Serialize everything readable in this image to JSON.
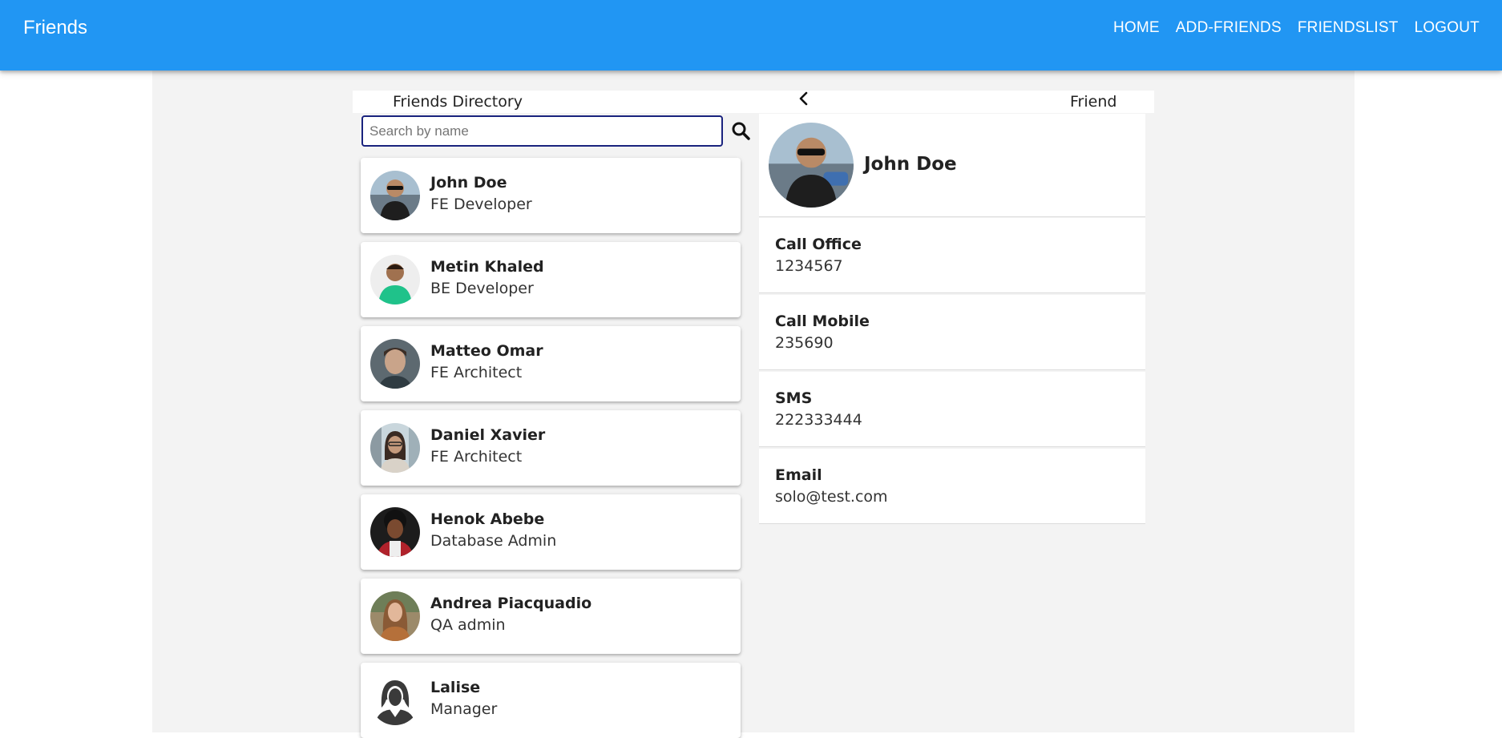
{
  "app": {
    "title": "Friends"
  },
  "nav": [
    {
      "label": "HOME"
    },
    {
      "label": "ADD-FRIENDS"
    },
    {
      "label": "FRIENDSLIST"
    },
    {
      "label": "LOGOUT"
    }
  ],
  "colors": {
    "appbar": "#2196f3",
    "page_bg": "#f3f3f3",
    "search_border": "#1a237e"
  },
  "directory": {
    "title": "Friends Directory",
    "search_placeholder": "Search by name",
    "search_icon": "search-icon"
  },
  "friends": [
    {
      "name": "John Doe",
      "role": "FE Developer",
      "avatar": "man-sunglasses-photo"
    },
    {
      "name": "Metin Khaled",
      "role": "BE Developer",
      "avatar": "man-green-shirt-photo"
    },
    {
      "name": "Matteo Omar",
      "role": "FE Architect",
      "avatar": "man-portrait-photo"
    },
    {
      "name": "Daniel Xavier",
      "role": "FE Architect",
      "avatar": "woman-glasses-photo"
    },
    {
      "name": "Henok Abebe",
      "role": "Database Admin",
      "avatar": "man-curly-hair-photo"
    },
    {
      "name": "Andrea Piacquadio",
      "role": "QA admin",
      "avatar": "woman-long-hair-photo"
    },
    {
      "name": "Lalise",
      "role": "Manager",
      "avatar": "woman-silhouette-icon"
    }
  ],
  "detail": {
    "header": "Friend",
    "back_icon": "chevron-left-icon",
    "name": "John Doe",
    "contacts": [
      {
        "label": "Call Office",
        "value": "1234567"
      },
      {
        "label": "Call Mobile",
        "value": "235690"
      },
      {
        "label": "SMS",
        "value": "222333444"
      },
      {
        "label": "Email",
        "value": "solo@test.com"
      }
    ]
  }
}
